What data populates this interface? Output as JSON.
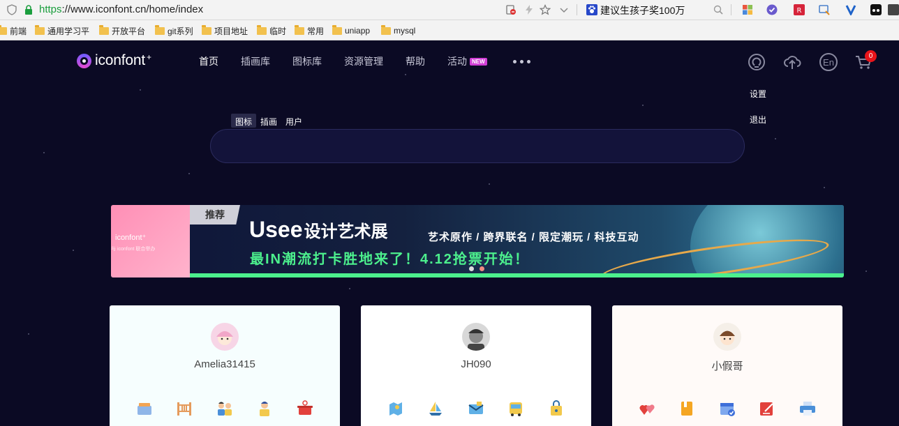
{
  "browser": {
    "url_scheme": "https",
    "url_rest": "://www.iconfont.cn/home/index",
    "promo_text": "建议生孩子奖100万"
  },
  "bookmarks": [
    {
      "label": "前端"
    },
    {
      "label": "通用学习平"
    },
    {
      "label": "开放平台"
    },
    {
      "label": "git系列"
    },
    {
      "label": "项目地址"
    },
    {
      "label": "临时"
    },
    {
      "label": "常用"
    },
    {
      "label": "uniapp"
    },
    {
      "label": "mysql"
    }
  ],
  "header": {
    "logo_text": "iconfont",
    "logo_plus": "+",
    "nav": [
      {
        "label": "首页",
        "active": true
      },
      {
        "label": "插画库"
      },
      {
        "label": "图标库"
      },
      {
        "label": "资源管理"
      },
      {
        "label": "帮助"
      },
      {
        "label": "活动",
        "badge": "NEW"
      }
    ],
    "lang_label": "En",
    "cart_count": "0"
  },
  "user_menu": {
    "settings": "设置",
    "logout": "退出"
  },
  "search": {
    "tabs": [
      {
        "label": "图标",
        "active": true
      },
      {
        "label": "插画"
      },
      {
        "label": "用户"
      }
    ],
    "placeholder": ""
  },
  "banner": {
    "tag": "推荐",
    "title_en": "Usee",
    "title_cn": "设计艺术展",
    "subtitle": "艺术原作 / 跨界联名 / 限定潮玩 / 科技互动",
    "line2": "最IN潮流打卡胜地来了！4.12抢票开始！",
    "left_logo": "iconfont⁺",
    "left_sub": "与 iconfont 联合举办",
    "slides_total": 2,
    "active_slide": 2
  },
  "cards": [
    {
      "username": "Amelia31415",
      "bg": "#f6fefe"
    },
    {
      "username": "JH090",
      "bg": "#ffffff"
    },
    {
      "username": "小假哥",
      "bg": "#fffaf8"
    }
  ],
  "colors": {
    "page_bg": "#0b0a24",
    "new_badge": "#d23fd6",
    "cart_badge": "#e8141a",
    "banner_accent": "#4cf08d"
  }
}
